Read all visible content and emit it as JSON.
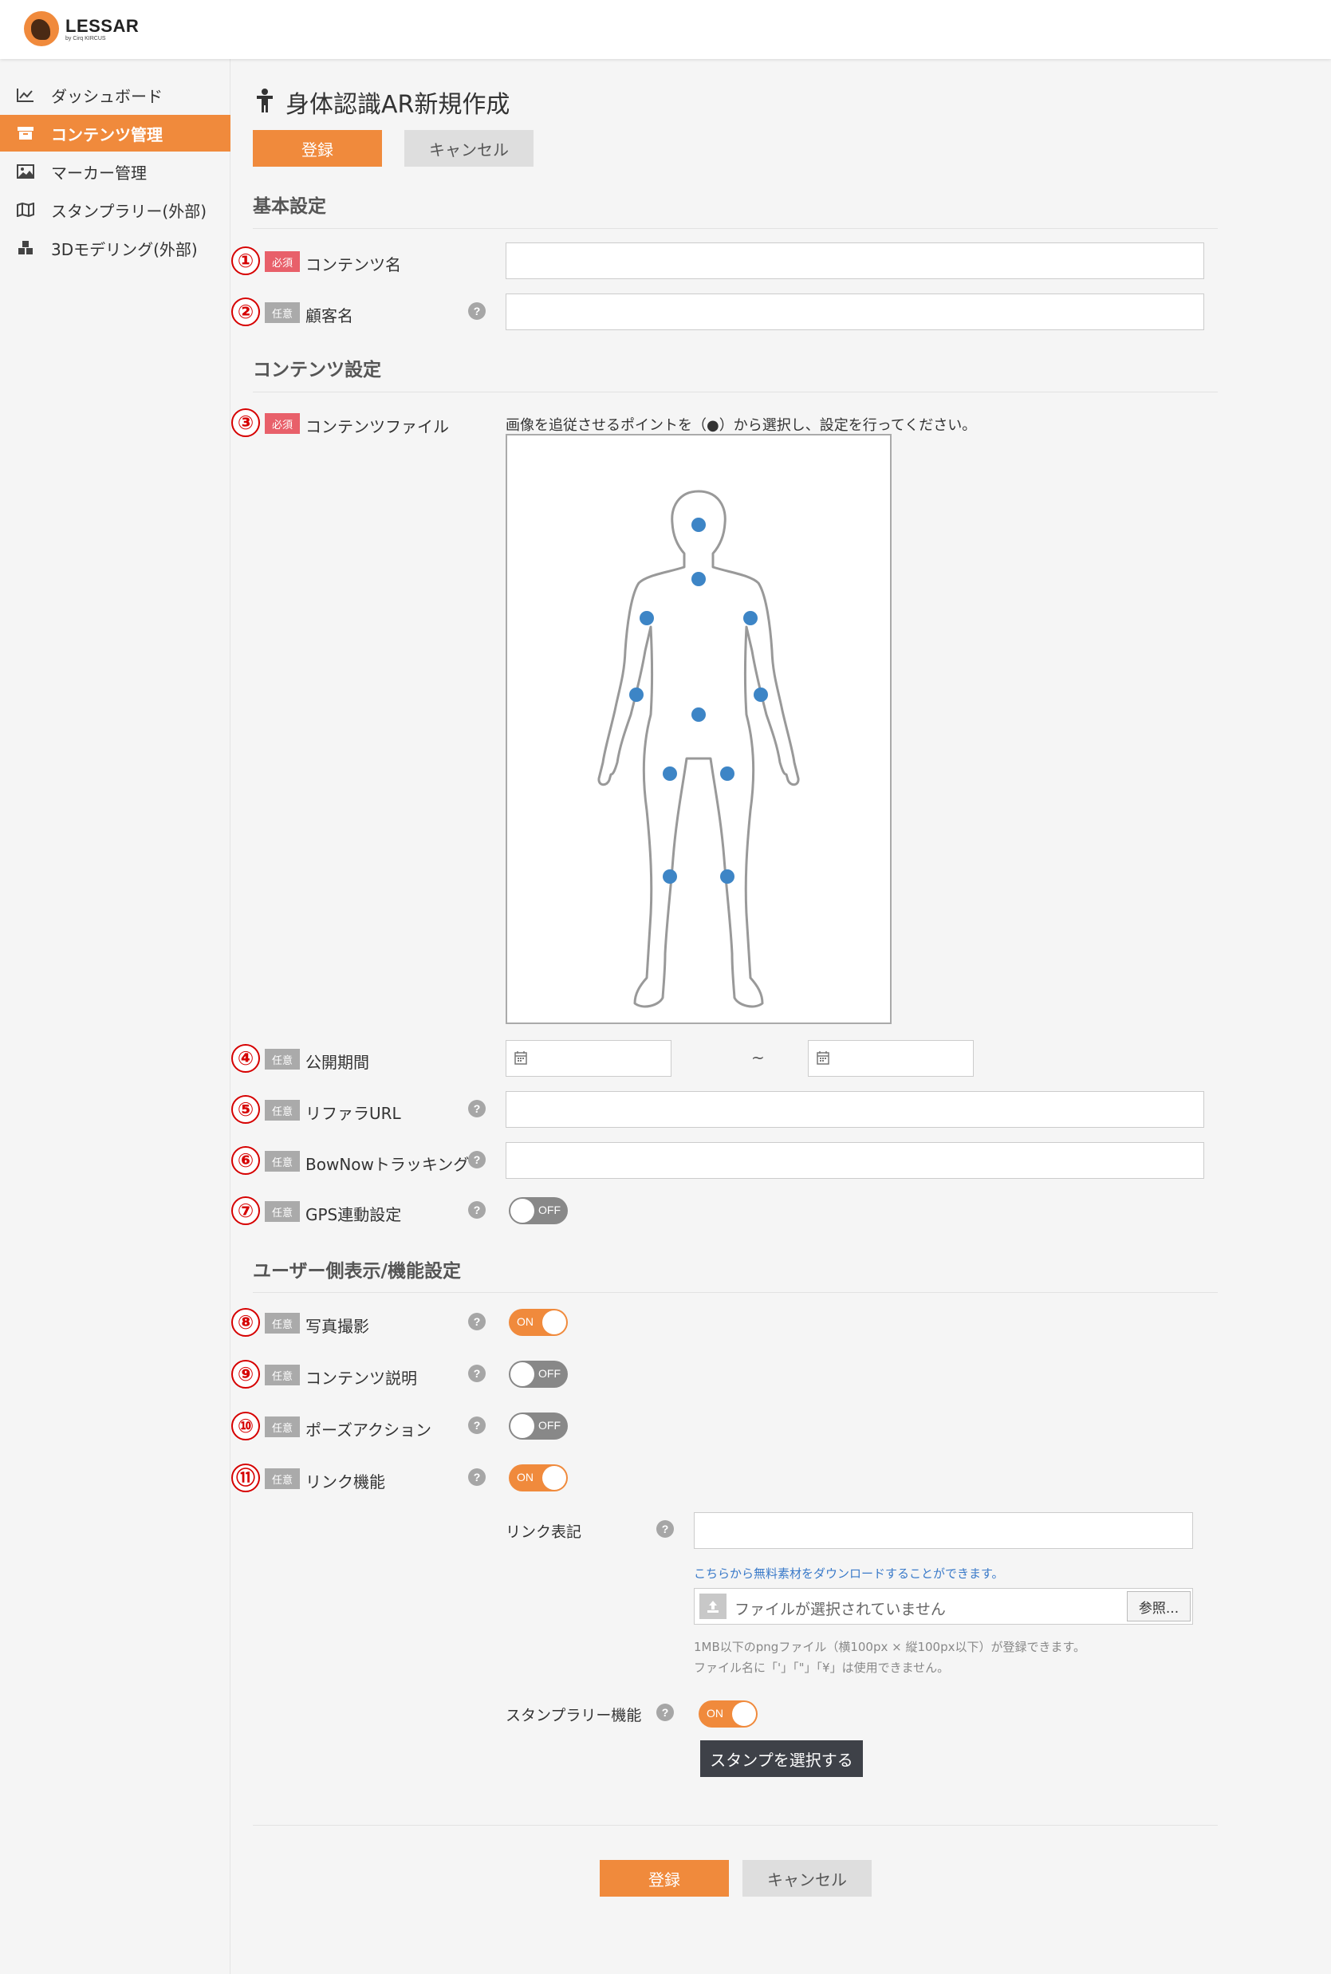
{
  "header": {
    "logo_title": "LESSAR",
    "logo_sub": "by Cirq KIRCUS"
  },
  "sidebar": {
    "items": [
      {
        "label": "ダッシュボード",
        "icon": "chart-line-icon",
        "active": false
      },
      {
        "label": "コンテンツ管理",
        "icon": "archive-box-icon",
        "active": true
      },
      {
        "label": "マーカー管理",
        "icon": "image-icon",
        "active": false
      },
      {
        "label": "スタンプラリー(外部)",
        "icon": "map-icon",
        "active": false
      },
      {
        "label": "3Dモデリング(外部)",
        "icon": "cubes-icon",
        "active": false
      }
    ]
  },
  "page": {
    "title": "身体認識AR新規作成",
    "title_icon": "person-icon",
    "register_label": "登録",
    "cancel_label": "キャンセル"
  },
  "sections": {
    "basic": "基本設定",
    "content": "コンテンツ設定",
    "user_side": "ユーザー側表示/機能設定"
  },
  "badges": {
    "required": "必須",
    "optional": "任意"
  },
  "fields": {
    "content_name": {
      "num": "①",
      "label": "コンテンツ名",
      "value": ""
    },
    "customer_name": {
      "num": "②",
      "label": "顧客名",
      "value": ""
    },
    "content_file": {
      "num": "③",
      "label": "コンテンツファイル",
      "instruction": "画像を追従させるポイントを（●）から選択し、設定を行ってください。"
    },
    "publish_period": {
      "num": "④",
      "label": "公開期間",
      "separator": "~",
      "start": "",
      "end": ""
    },
    "referrer_url": {
      "num": "⑤",
      "label": "リファラURL",
      "value": ""
    },
    "bownow": {
      "num": "⑥",
      "label": "BowNowトラッキング",
      "value": ""
    },
    "gps": {
      "num": "⑦",
      "label": "GPS連動設定",
      "toggle": "OFF"
    },
    "photo": {
      "num": "⑧",
      "label": "写真撮影",
      "toggle": "ON"
    },
    "content_desc": {
      "num": "⑨",
      "label": "コンテンツ説明",
      "toggle": "OFF"
    },
    "pose_action": {
      "num": "⑩",
      "label": "ポーズアクション",
      "toggle": "OFF"
    },
    "link": {
      "num": "⑪",
      "label": "リンク機能",
      "toggle": "ON"
    }
  },
  "link_settings": {
    "link_label": "リンク表記",
    "link_value": "",
    "download_text": "こちらから無料素材をダウンロードすることができます。",
    "file_placeholder": "ファイルが選択されていません",
    "browse_label": "参照...",
    "note1": "1MB以下のpngファイル（横100px × 縦100px以下）が登録できます。",
    "note2": "ファイル名に「'」「\"」「¥」は使用できません。",
    "stamp_rally_label": "スタンプラリー機能",
    "stamp_rally_toggle": "ON",
    "select_stamp_label": "スタンプを選択する"
  },
  "help_mark": "?",
  "colors": {
    "accent": "#f08a3c",
    "required_badge": "#e8606a",
    "optional_badge": "#aaaaaa",
    "body_point": "#3d85c6",
    "annotation_red": "#d60000",
    "stamp_button": "#3e4148"
  }
}
